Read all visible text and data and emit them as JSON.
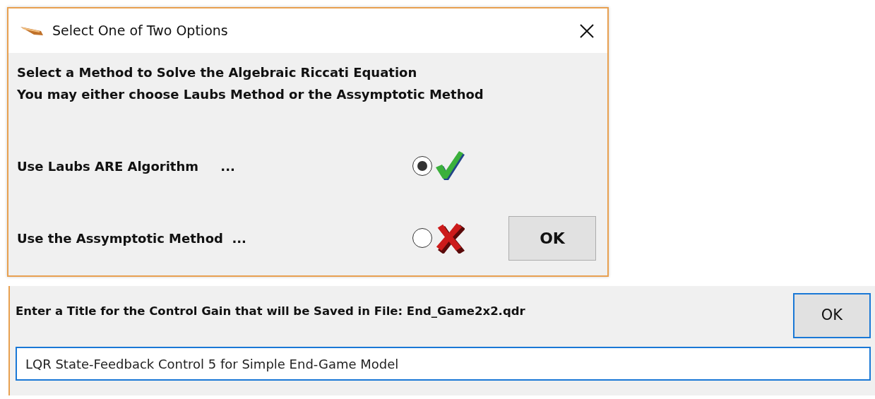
{
  "dialog": {
    "title": "Select One of Two Options",
    "instructions": [
      "Select a Method to Solve the Algebraic Riccati Equation",
      "You may either choose Laubs Method or the Assymptotic Method"
    ],
    "options": [
      {
        "label": "Use Laubs ARE Algorithm     ...",
        "selected": true,
        "kind": "check"
      },
      {
        "label": "Use the Assymptotic Method  ...",
        "selected": false,
        "kind": "cross"
      }
    ],
    "ok_button": "OK"
  },
  "title_entry": {
    "prompt": "Enter a Title for the Control Gain that will be Saved in File: End_Game2x2.qdr",
    "ok_button": "OK",
    "value": "LQR State-Feedback Control 5 for Simple End-Game Model"
  }
}
